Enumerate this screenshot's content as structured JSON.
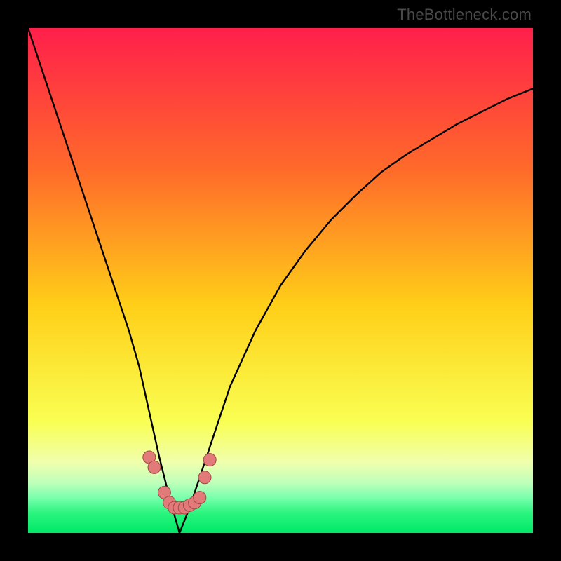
{
  "watermark": "TheBottleneck.com",
  "colors": {
    "background": "#000000",
    "gradient_top": "#ff1f4b",
    "gradient_mid": "#ffd400",
    "gradient_low": "#f6ff7a",
    "gradient_green_light": "#66ff99",
    "gradient_green": "#00e868",
    "curve_stroke": "#000000",
    "marker_fill": "#e27a7a",
    "marker_stroke": "#a04848"
  },
  "chart_data": {
    "type": "line",
    "title": "",
    "xlabel": "",
    "ylabel": "",
    "xlim": [
      0,
      100
    ],
    "ylim": [
      0,
      100
    ],
    "grid": false,
    "legend": "none",
    "min_x": 30,
    "series": [
      {
        "name": "bottleneck-curve",
        "x": [
          0,
          5,
          10,
          15,
          20,
          22,
          24,
          26,
          28,
          30,
          32,
          34,
          36,
          38,
          40,
          45,
          50,
          55,
          60,
          65,
          70,
          75,
          80,
          85,
          90,
          95,
          100
        ],
        "values": [
          100,
          85,
          70,
          55,
          40,
          33,
          24,
          15,
          7,
          0,
          5,
          11,
          17,
          23,
          29,
          40,
          49,
          56,
          62,
          67,
          71.5,
          75,
          78,
          81,
          83.5,
          86,
          88
        ]
      }
    ],
    "markers": {
      "name": "highlight-points",
      "x": [
        24,
        25,
        27,
        28,
        29,
        30,
        31,
        32,
        33,
        34,
        35,
        36
      ],
      "values": [
        15.0,
        13.0,
        8.0,
        6.0,
        5.0,
        5.0,
        5.0,
        5.5,
        6.0,
        7.0,
        11.0,
        14.5
      ]
    }
  }
}
